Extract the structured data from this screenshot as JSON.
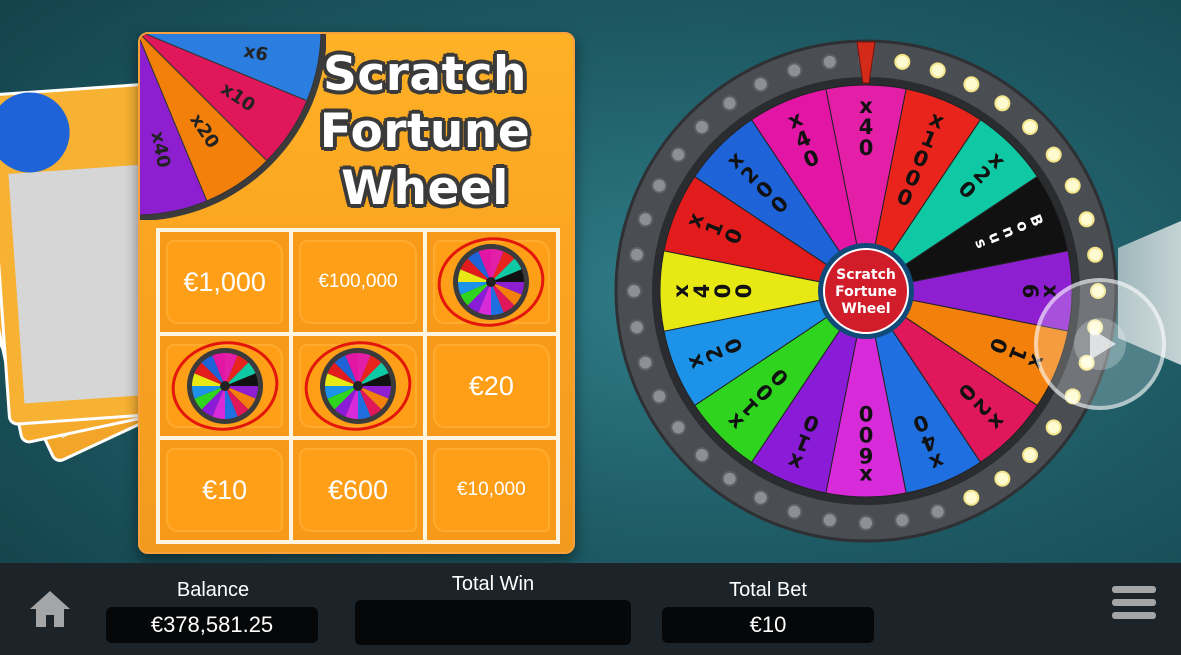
{
  "game": {
    "title_lines": [
      "Scratch",
      "Fortune",
      "Wheel"
    ],
    "hub_lines": [
      "Scratch",
      "Fortune",
      "Wheel"
    ]
  },
  "scratch_card": {
    "cells": [
      {
        "type": "value",
        "text": "€1,000",
        "size": "big"
      },
      {
        "type": "value",
        "text": "€100,000",
        "size": "small"
      },
      {
        "type": "wheel-symbol",
        "circled": true
      },
      {
        "type": "wheel-symbol",
        "circled": true
      },
      {
        "type": "wheel-symbol",
        "circled": true
      },
      {
        "type": "value",
        "text": "€20",
        "size": "big"
      },
      {
        "type": "value",
        "text": "€10",
        "size": "big"
      },
      {
        "type": "value",
        "text": "€600",
        "size": "big"
      },
      {
        "type": "value",
        "text": "€10,000",
        "size": "small"
      }
    ],
    "corner_wheel_labels": [
      "x40",
      "x20",
      "x10",
      "x6"
    ]
  },
  "wheel": {
    "segments": [
      {
        "label": "x40",
        "color": "#e21fa6"
      },
      {
        "label": "x1000",
        "color": "#e8241d"
      },
      {
        "label": "x20",
        "color": "#0fc9a5"
      },
      {
        "label": "Bonus",
        "color": "#111111"
      },
      {
        "label": "x6",
        "color": "#8d1fd1"
      },
      {
        "label": "x10",
        "color": "#f2800b"
      },
      {
        "label": "x20",
        "color": "#e0175a"
      },
      {
        "label": "x40",
        "color": "#1f6fe0"
      },
      {
        "label": "x600",
        "color": "#d72ad8"
      },
      {
        "label": "x10",
        "color": "#8a1bd6"
      },
      {
        "label": "x100",
        "color": "#2fd41f"
      },
      {
        "label": "x20",
        "color": "#1c92e8"
      },
      {
        "label": "x400",
        "color": "#e8e815"
      },
      {
        "label": "x10",
        "color": "#e21c1c"
      },
      {
        "label": "x200",
        "color": "#1e63d8"
      },
      {
        "label": "x40",
        "color": "#e215a5"
      }
    ],
    "pointer_color": "#d32a1a"
  },
  "footer": {
    "balance_label": "Balance",
    "balance_value": "€378,581.25",
    "total_win_label": "Total Win",
    "total_win_value": "",
    "total_bet_label": "Total Bet",
    "total_bet_value": "€10"
  },
  "icons": {
    "home": "home-icon",
    "menu": "menu-icon",
    "spin": "play-icon"
  }
}
